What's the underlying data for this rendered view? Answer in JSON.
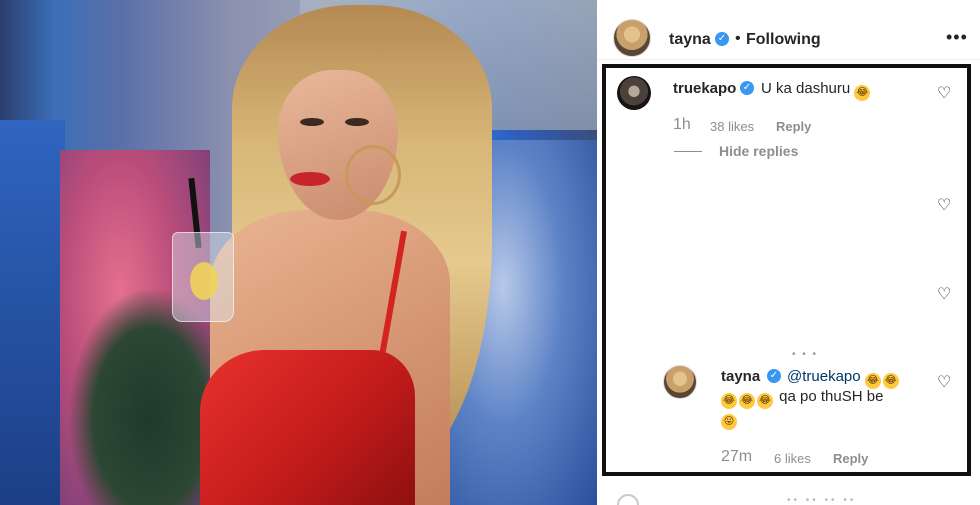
{
  "post": {
    "header": {
      "username": "tayna",
      "verified": true,
      "separator": "•",
      "follow_label": "Following",
      "more_label": "•••"
    }
  },
  "comments": [
    {
      "username": "truekapo",
      "verified": true,
      "text": "U ka dashuru",
      "emoji_end": "😂",
      "time": "1h",
      "likes": "38 likes",
      "reply_label": "Reply",
      "hide_replies_label": "Hide replies"
    }
  ],
  "reply": {
    "username": "tayna",
    "verified": true,
    "mention": "@truekapo",
    "line1_emojis": [
      "😂",
      "😂"
    ],
    "line2_emojis": [
      "😂",
      "😂",
      "😂"
    ],
    "text": "qa po thuSH be",
    "last_emoji": "😛",
    "time": "27m",
    "likes": "6 likes",
    "reply_label": "Reply"
  },
  "icons": {
    "heart": "♡",
    "verified": "✓"
  },
  "colors": {
    "verified_blue": "#3897f0",
    "text": "#262626",
    "muted": "#8e8e8e",
    "frame": "#111111",
    "dress_red": "#c41c1c"
  }
}
